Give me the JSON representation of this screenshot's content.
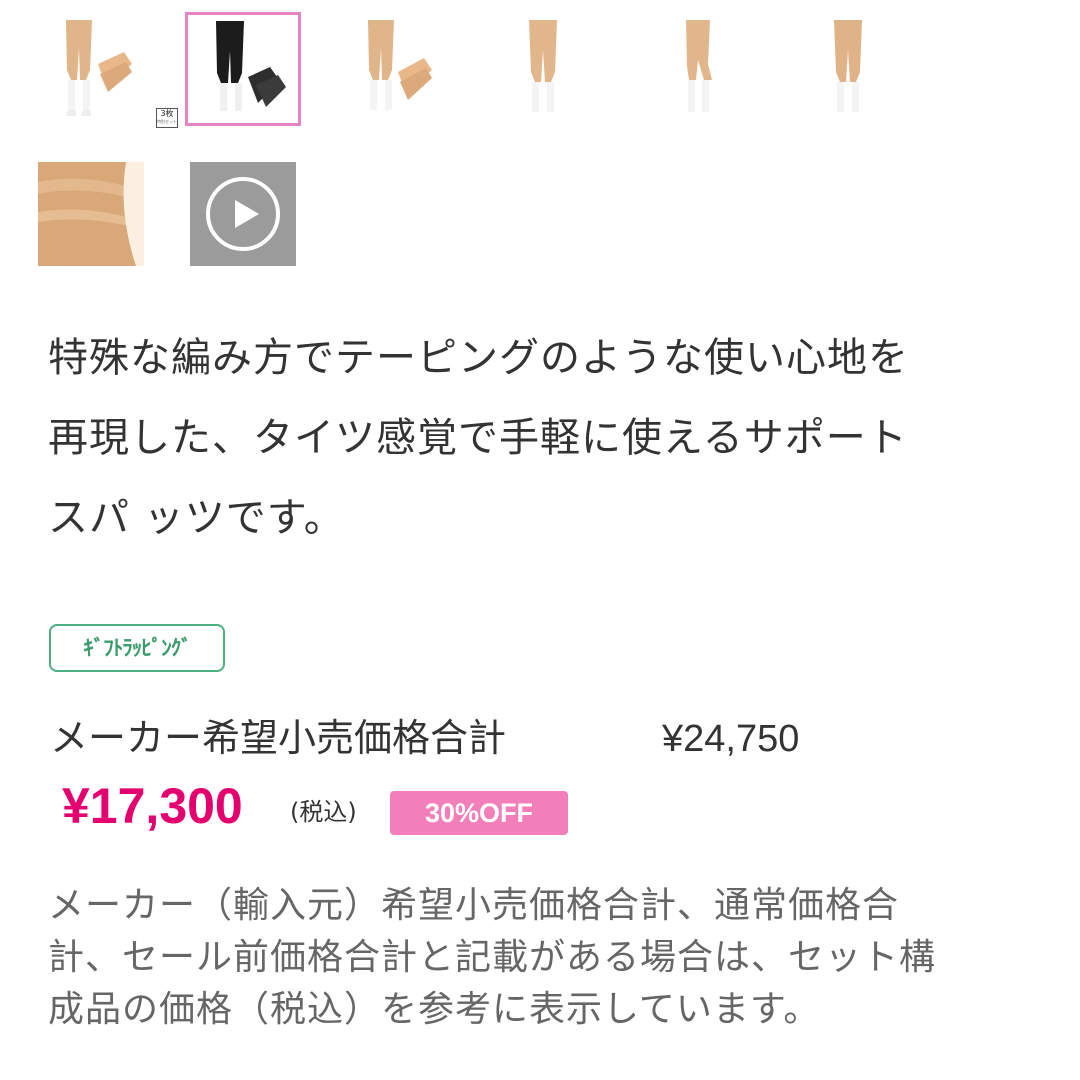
{
  "gallery": {
    "thumbnails": [
      {
        "name": "thumb-beige-set-3pack",
        "badge": "3枚",
        "badge_sub": "特別セット"
      },
      {
        "name": "thumb-black-set",
        "selected": true
      },
      {
        "name": "thumb-beige-set"
      },
      {
        "name": "thumb-beige-front"
      },
      {
        "name": "thumb-beige-side"
      },
      {
        "name": "thumb-beige-back"
      },
      {
        "name": "thumb-fabric-closeup"
      },
      {
        "name": "thumb-video",
        "icon": "play-icon"
      }
    ],
    "selected_border_color": "#e684c1"
  },
  "description": "特殊な編み方でテーピングのような使い心地を\n再現した、タイツ感覚で手軽に使えるサポート\nスパ ッツです。",
  "gift_tag": {
    "label": "ｷﾞﾌﾄﾗｯﾋﾟﾝｸﾞ",
    "color": "#4caf80"
  },
  "pricing": {
    "maker_price_label": "メーカー希望小売価格合計",
    "maker_price": "¥24,750",
    "sale_price": "¥17,300",
    "tax_note": "(税込)",
    "discount_badge": "30%OFF",
    "sale_color": "#e4006e",
    "badge_color": "#f27fb9"
  },
  "footnote": "メーカー（輸入元）希望小売価格合計、通常価格合\n計、セール前価格合計と記載がある場合は、セット構\n成品の価格（税込）を参考に表示しています。"
}
